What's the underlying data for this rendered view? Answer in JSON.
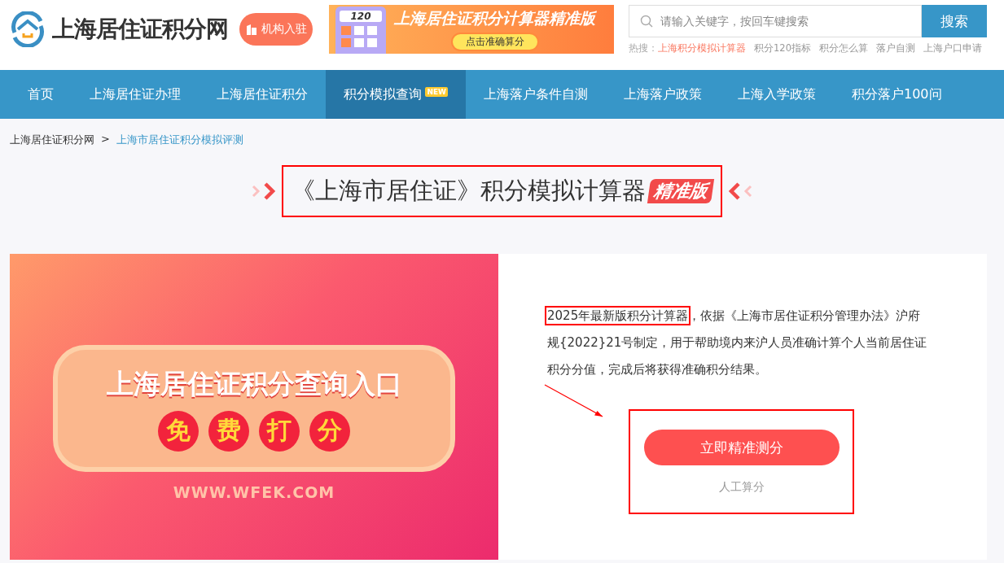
{
  "header": {
    "logo_text": "上海居住证积分网",
    "join_button": "机构入驻",
    "ad": {
      "display": "120",
      "title": "上海居住证积分计算器精准版",
      "cta": "点击准确算分"
    },
    "search": {
      "placeholder": "请输入关键字，按回车键搜索",
      "button": "搜索"
    },
    "hot": {
      "label": "热搜：",
      "links": [
        {
          "text": "上海积分模拟计算器",
          "highlight": true
        },
        {
          "text": "积分120指标",
          "highlight": false
        },
        {
          "text": "积分怎么算",
          "highlight": false
        },
        {
          "text": "落户自测",
          "highlight": false
        },
        {
          "text": "上海户口申请",
          "highlight": false
        }
      ]
    }
  },
  "nav": [
    {
      "label": "首页",
      "selected": false
    },
    {
      "label": "上海居住证办理",
      "selected": false
    },
    {
      "label": "上海居住证积分",
      "selected": false
    },
    {
      "label": "积分模拟查询",
      "selected": true,
      "badge": "NEW"
    },
    {
      "label": "上海落户条件自测",
      "selected": false
    },
    {
      "label": "上海落户政策",
      "selected": false
    },
    {
      "label": "上海入学政策",
      "selected": false
    },
    {
      "label": "积分落户100问",
      "selected": false
    }
  ],
  "breadcrumb": {
    "separator": ">",
    "items": [
      {
        "text": "上海居住证积分网",
        "current": false
      },
      {
        "text": "上海市居住证积分模拟评测",
        "current": true
      }
    ]
  },
  "page_title": {
    "text": "《上海市居住证》积分模拟计算器",
    "tag": "精准版"
  },
  "banner": {
    "headline": "上海居住证积分查询入口",
    "chips": [
      "免",
      "费",
      "打",
      "分"
    ],
    "url": "WWW.WFEK.COM"
  },
  "intro": {
    "highlight": "2025年最新版积分计算器",
    "text": "，依据《上海市居住证积分管理办法》沪府规{2022}21号制定，用于帮助境内来沪人员准确计算个人当前居住证积分分值，完成后将获得准确积分结果。"
  },
  "actions": {
    "primary": "立即精准测分",
    "secondary": "人工算分"
  }
}
